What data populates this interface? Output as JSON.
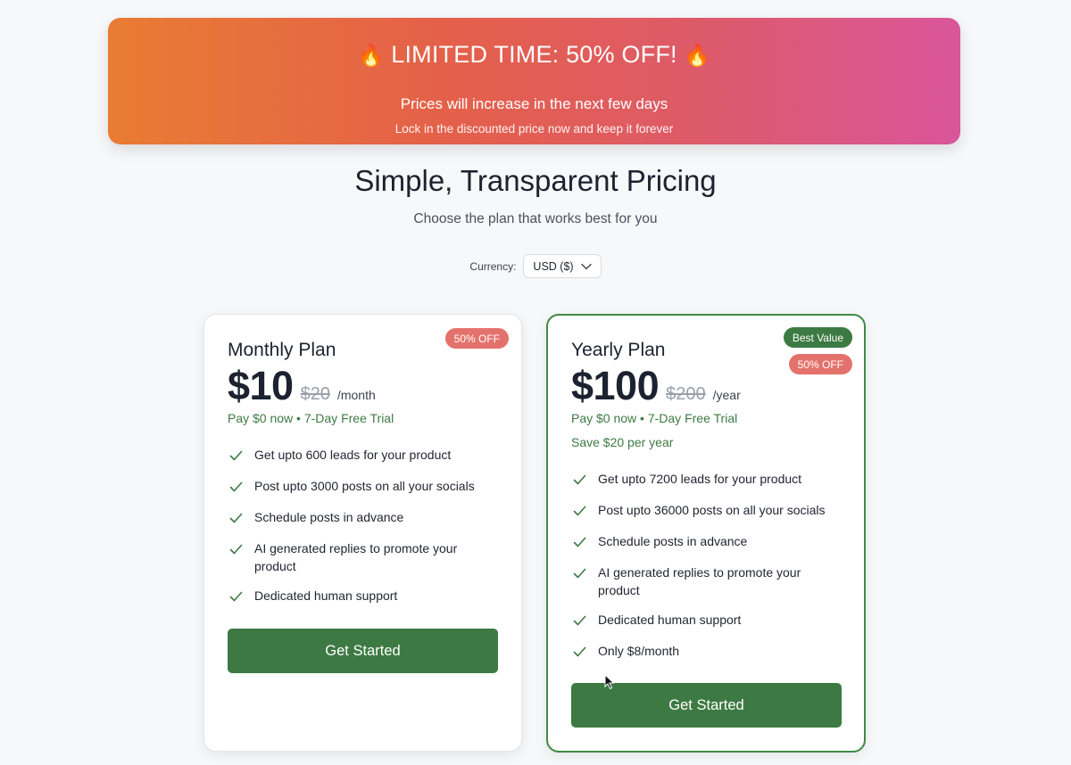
{
  "banner": {
    "flame": "🔥",
    "title": "LIMITED TIME: 50% OFF!",
    "subtitle": "Prices will increase in the next few days",
    "note": "Lock in the discounted price now and keep it forever"
  },
  "header": {
    "title": "Simple, Transparent Pricing",
    "subtitle": "Choose the plan that works best for you"
  },
  "currency": {
    "label": "Currency:",
    "selected": "USD ($)"
  },
  "plans": [
    {
      "name": "Monthly Plan",
      "badges": [
        "50% OFF"
      ],
      "price": "$10",
      "old_price": "$20",
      "period": "/month",
      "trial": "Pay $0 now • 7-Day Free Trial",
      "features": [
        "Get upto 600 leads for your product",
        "Post upto 3000 posts on all your socials",
        "Schedule posts in advance",
        "AI generated replies to promote your product",
        "Dedicated human support"
      ],
      "cta": "Get Started"
    },
    {
      "name": "Yearly Plan",
      "badges": [
        "Best Value",
        "50% OFF"
      ],
      "price": "$100",
      "old_price": "$200",
      "period": "/year",
      "trial": "Pay $0 now • 7-Day Free Trial",
      "savings": "Save $20 per year",
      "features": [
        "Get upto 7200 leads for your product",
        "Post upto 36000 posts on all your socials",
        "Schedule posts in advance",
        "AI generated replies to promote your product",
        "Dedicated human support",
        "Only $8/month"
      ],
      "cta": "Get Started"
    }
  ],
  "colors": {
    "accent_green": "#3d7a43",
    "discount_red": "#e4726c",
    "banner_start": "#e97c33",
    "banner_end": "#d9569a"
  }
}
